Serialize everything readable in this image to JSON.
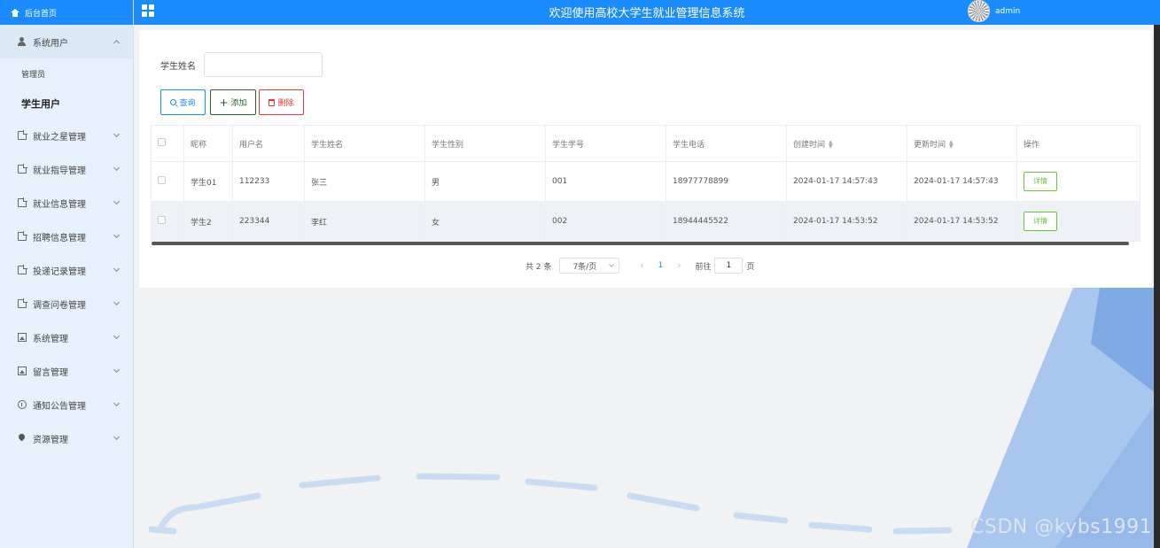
{
  "sidebar": {
    "home_label": "后台首页",
    "system_users": "系统用户",
    "sub_items": [
      "管理员",
      "学生用户"
    ],
    "items": [
      "就业之星管理",
      "就业指导管理",
      "就业信息管理",
      "招聘信息管理",
      "投递记录管理",
      "调查问卷管理",
      "系统管理",
      "留言管理",
      "通知公告管理",
      "资源管理"
    ]
  },
  "header": {
    "title": "欢迎使用高校大学生就业管理信息系统",
    "username": "admin"
  },
  "search": {
    "label": "学生姓名",
    "value": ""
  },
  "buttons": {
    "search": "查询",
    "add": "添加",
    "delete": "删除"
  },
  "table": {
    "headers": [
      "昵称",
      "用户名",
      "学生姓名",
      "学生性别",
      "学生学号",
      "学生电话",
      "创建时间",
      "更新时间",
      "操作"
    ],
    "rows": [
      {
        "nickname": "学生01",
        "username": "112233",
        "name": "张三",
        "gender": "男",
        "student_no": "001",
        "phone": "18977778899",
        "created": "2024-01-17 14:57:43",
        "updated": "2024-01-17 14:57:43",
        "action": "详情"
      },
      {
        "nickname": "学生2",
        "username": "223344",
        "name": "李红",
        "gender": "女",
        "student_no": "002",
        "phone": "18944445522",
        "created": "2024-01-17 14:53:52",
        "updated": "2024-01-17 14:53:52",
        "action": "详情"
      }
    ]
  },
  "pagination": {
    "total": "共 2 条",
    "page_size": "7条/页",
    "current_page": "1",
    "goto_label": "前往",
    "goto_value": "1",
    "page_suffix": "页"
  },
  "watermark": "CSDN @kybs1991",
  "colors": {
    "primary": "#1a8cff",
    "sidebar_bg": "#e6f1fb",
    "success": "#67c23a",
    "danger": "#e23b3b"
  }
}
